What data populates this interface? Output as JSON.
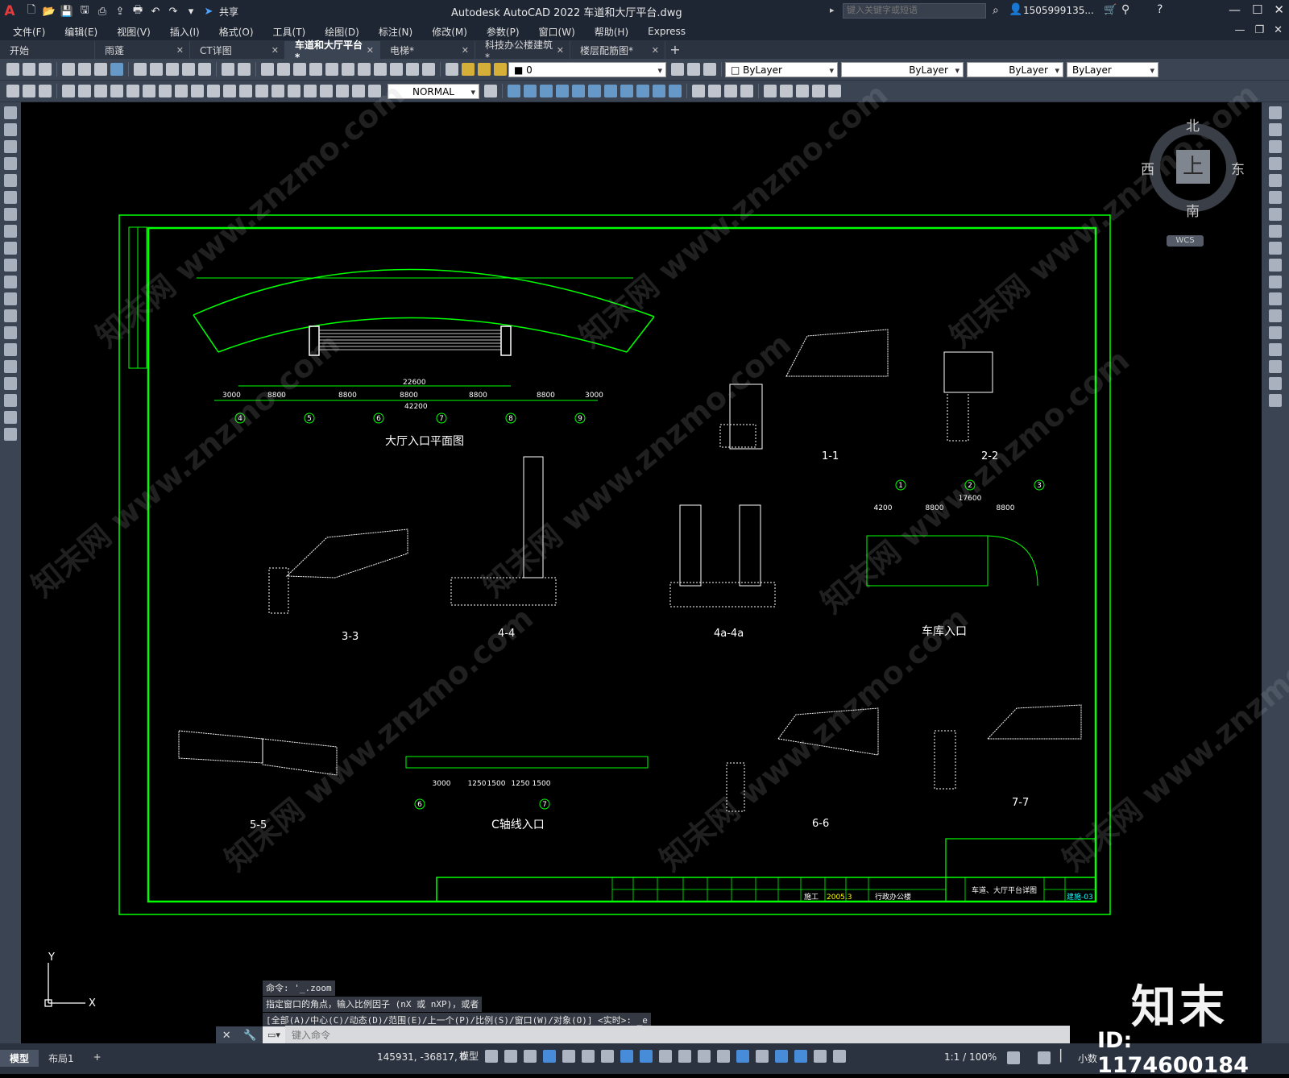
{
  "app": {
    "logo": "A",
    "title": "Autodesk AutoCAD 2022    车道和大厅平台.dwg",
    "share_label": "共享",
    "search_placeholder": "键入关键字或短语",
    "user": "1505999135...",
    "window_controls": [
      "—",
      "☐",
      "✕"
    ],
    "doc_controls": [
      "—",
      "❐",
      "✕"
    ]
  },
  "menu": [
    "文件(F)",
    "编辑(E)",
    "视图(V)",
    "插入(I)",
    "格式(O)",
    "工具(T)",
    "绘图(D)",
    "标注(N)",
    "修改(M)",
    "参数(P)",
    "窗口(W)",
    "帮助(H)",
    "Express"
  ],
  "tabs": [
    {
      "label": "开始",
      "active": false,
      "closable": false
    },
    {
      "label": "雨蓬",
      "active": false,
      "closable": true
    },
    {
      "label": "CT详图",
      "active": false,
      "closable": true
    },
    {
      "label": "车道和大厅平台*",
      "active": true,
      "closable": true
    },
    {
      "label": "电梯*",
      "active": false,
      "closable": true
    },
    {
      "label": "科技办公楼建筑*",
      "active": false,
      "closable": true
    },
    {
      "label": "楼层配筋图*",
      "active": false,
      "closable": true
    }
  ],
  "toolbar": {
    "layer_value": "0",
    "color_value": "ByLayer",
    "linetype_value": "ByLayer",
    "lineweight_value": "ByLayer",
    "plotstyle_value": "ByLayer",
    "dimstyle_value": "NORMAL"
  },
  "viewcube": {
    "north": "北",
    "south": "南",
    "east": "东",
    "west": "西",
    "top_face": "上",
    "wcs": "WCS"
  },
  "drawing": {
    "titles": {
      "hall_plan": "大厅入口平面图",
      "s11": "1-1",
      "s22": "2-2",
      "s33": "3-3",
      "s44": "4-4",
      "s4a": "4a-4a",
      "garage": "车库入口",
      "s55": "5-5",
      "c_axis": "C轴线入口",
      "s66": "6-6",
      "s77": "7-7"
    },
    "plan_dims": [
      "3000",
      "8800",
      "8800",
      "8800",
      "8800",
      "8800",
      "3000"
    ],
    "plan_total": "42200",
    "plan_inner": "22600",
    "plan_axes": [
      "4",
      "5",
      "6",
      "7",
      "8",
      "9"
    ],
    "garage_axes": [
      "1",
      "2",
      "3"
    ],
    "garage_dims": [
      "4200",
      "8800",
      "8800"
    ],
    "garage_total": "17600",
    "c_axis_dims": [
      "3000",
      "1250",
      "1500",
      "1250",
      "1500"
    ],
    "c_axis_axes": [
      "6",
      "7"
    ],
    "title_block": {
      "drawing_name": "车道、大厅平台详图",
      "sheet_no": "建施-03",
      "date": "2005.3",
      "stage": "施工",
      "project": "行政办公楼"
    }
  },
  "command": {
    "history": [
      "命令: '_.zoom",
      "指定窗口的角点，输入比例因子 (nX 或 nXP)，或者",
      "[全部(A)/中心(C)/动态(D)/范围(E)/上一个(P)/比例(S)/窗口(W)/对象(O)] <实时>: _e"
    ],
    "placeholder": "键入命令"
  },
  "status": {
    "layout_tabs": [
      {
        "label": "模型",
        "active": true
      },
      {
        "label": "布局1",
        "active": false
      }
    ],
    "add_tab": "+",
    "coords": "145931, -36817, 0",
    "model_label": "模型",
    "scale": "1:1 / 100%",
    "units": "小数"
  },
  "watermark": {
    "brand": "知末",
    "id": "ID: 1174600184",
    "repeat_text": "知末网 www.znzmo.com"
  },
  "colors": {
    "frame": "#00ff00",
    "background": "#000000",
    "ui_dark": "#1f2633",
    "ui_mid": "#3b4453"
  }
}
